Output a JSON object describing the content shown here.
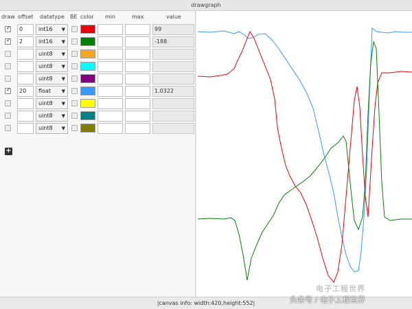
{
  "window": {
    "title": "drawgraph"
  },
  "table": {
    "headers": {
      "draw": "draw",
      "offset": "offset",
      "datatype": "datatype",
      "be": "BE",
      "color": "color",
      "min": "min",
      "max": "max",
      "value": "value"
    },
    "rows": [
      {
        "draw": true,
        "offset": "0",
        "datatype": "int16",
        "be": false,
        "color": "#e8000b",
        "min": "",
        "max": "",
        "value": "99"
      },
      {
        "draw": true,
        "offset": "2",
        "datatype": "int16",
        "be": false,
        "color": "#008000",
        "min": "",
        "max": "",
        "value": "-188"
      },
      {
        "draw": false,
        "offset": "",
        "datatype": "uint8",
        "be": false,
        "color": "#f5a623",
        "min": "",
        "max": "",
        "value": ""
      },
      {
        "draw": false,
        "offset": "",
        "datatype": "uint8",
        "be": false,
        "color": "#00ffff",
        "min": "",
        "max": "",
        "value": ""
      },
      {
        "draw": false,
        "offset": "",
        "datatype": "uint8",
        "be": false,
        "color": "#800080",
        "min": "",
        "max": "",
        "value": ""
      },
      {
        "draw": true,
        "offset": "20",
        "datatype": "float",
        "be": false,
        "color": "#3399ff",
        "min": "",
        "max": "",
        "value": "1.0322"
      },
      {
        "draw": false,
        "offset": "",
        "datatype": "uint8",
        "be": false,
        "color": "#ffff00",
        "min": "",
        "max": "",
        "value": ""
      },
      {
        "draw": false,
        "offset": "",
        "datatype": "uint8",
        "be": false,
        "color": "#008080",
        "min": "",
        "max": "",
        "value": ""
      },
      {
        "draw": false,
        "offset": "",
        "datatype": "uint8",
        "be": false,
        "color": "#808000",
        "min": "",
        "max": "",
        "value": ""
      }
    ],
    "add_label": "+"
  },
  "icons": {
    "add": "plus-icon",
    "check": "checkmark-icon",
    "dropdown": "chevron-down-icon"
  },
  "status": {
    "text": "|canvas info: width:420,height:552|"
  },
  "watermark": {
    "text": "头条号 / 电子工程世界",
    "logo_text": "电子工程世界"
  },
  "traces": [
    {
      "name": "",
      "color": "#e8000b"
    },
    {
      "name": "",
      "color": "#008000"
    },
    {
      "name": "",
      "color": "#3399ff"
    }
  ]
}
